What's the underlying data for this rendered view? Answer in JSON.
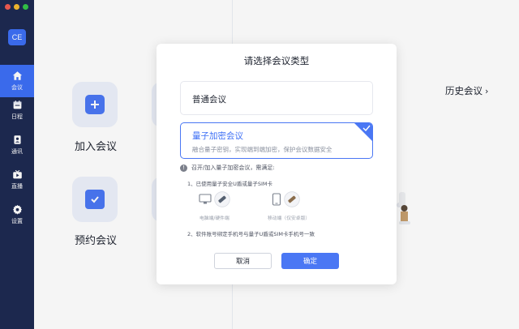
{
  "sidebar": {
    "avatar": "CE",
    "items": [
      {
        "label": "会议",
        "icon": "home-icon"
      },
      {
        "label": "日程",
        "icon": "calendar-icon"
      },
      {
        "label": "通讯",
        "icon": "contacts-icon"
      },
      {
        "label": "直播",
        "icon": "live-icon"
      },
      {
        "label": "设置",
        "icon": "gear-icon"
      }
    ]
  },
  "main": {
    "join_label": "加入会议",
    "schedule_label": "预约会议",
    "history_label": "历史会议"
  },
  "modal": {
    "title": "请选择会议类型",
    "option_normal": "普通会议",
    "option_quantum": "量子加密会议",
    "option_quantum_desc": "融合量子密钥，实现端到端加密，保护会议数据安全",
    "notice": "召开/加入量子加密会议，需满足:",
    "step1": "1、已使用量子安全U盾或量子SIM卡",
    "device_pc": "电脑端/硬件端",
    "device_mobile": "移动端（仅安卓版）",
    "step2": "2、软件账号绑定手机号与量子U盾或SIM卡手机号一致",
    "cancel": "取消",
    "confirm": "确定"
  },
  "colors": {
    "sidebar": "#1e2a52",
    "accent": "#4a77f4"
  }
}
